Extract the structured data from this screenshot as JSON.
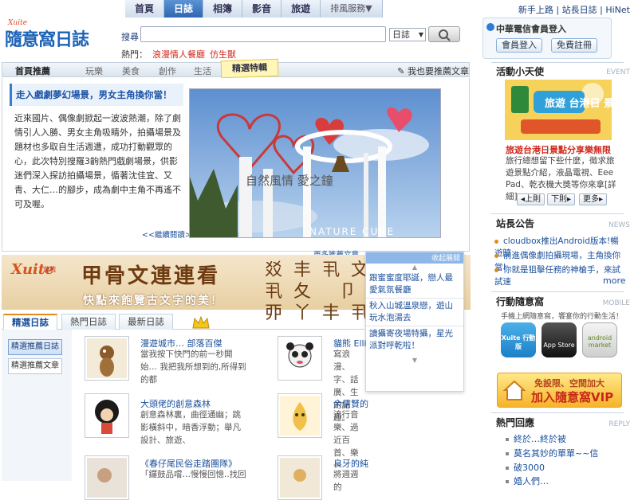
{
  "nav": {
    "tabs": [
      "首頁",
      "日誌",
      "相簿",
      "影音",
      "旅遊"
    ],
    "active_index": 1,
    "more": "排風服務▼",
    "top_links": [
      "新手上路",
      "站長日誌",
      "HiNet"
    ],
    "sep": "|"
  },
  "logo": {
    "xuite": "Xuite",
    "name": "隨意窩日誌"
  },
  "search": {
    "label": "搜尋",
    "value": "",
    "scope": "日誌",
    "hot_label": "熱門：",
    "hot_items": [
      "浪漫情人餐廳",
      "仿生獸"
    ]
  },
  "member": {
    "title": "中華電信會員登入",
    "login": "會員登入",
    "register": "免費註冊"
  },
  "main_tabs": {
    "first": "首頁推薦",
    "items": [
      "玩樂",
      "美食",
      "創作",
      "生活"
    ],
    "featured_badge": "精選特輯",
    "recent": "我也要推薦文章"
  },
  "feature": {
    "title": "走入戲劇夢幻場景，男女主角換你當！",
    "body": "近來國片、偶像劇掀起一波波熱潮，除了劇情引人入勝、男女主角吸睛外，拍攝場景及題材也多取自生活週遭，成功打動觀眾的心，此次特別搜羅3齣熱門戲劇場景，供影迷們深入探訪拍攝場景，循著沈佳宜、又青、大仁…的腳步，成為劇中主角不再遙不可及喔。",
    "more": "<<繼續閱讀>>",
    "photo_text": "自然風情 愛之鐘",
    "photo_text2": "NATURE     CURE",
    "more_recommend": "更多推薦文章"
  },
  "banner": {
    "xuite": "Xuite",
    "game": "遊戲",
    "title": "甲骨文連連看",
    "sub": "快點來飽覽古文字的美！",
    "glyphs": "㸚丰丮文 丣丰丮夂 卩丩丰丮 丣丫丰丮"
  },
  "overlay": {
    "items": [
      "跟蜜蜜度耶誕，戀人最愛氣氛餐廳",
      "秋入山城溫泉戀，遊山玩水泡湯去",
      "讀攝寄夜場特攝，星光派對呼乾啦！"
    ],
    "tag": "收起展開"
  },
  "bottom_tabs": [
    "精選日誌",
    "熱門日誌",
    "最新日誌"
  ],
  "left_nav": [
    "精選推薦日誌",
    "精選推薦文章"
  ],
  "entries": [
    {
      "title": "漫遊城市…  部落百傑",
      "body": "當我按下快門的前一秒開始… 我把我所想到的,所得到的都",
      "col": 0
    },
    {
      "title": "大頭佬的創意森林",
      "body": "創意森林裏，曲徑通幽；跳影橫斜中，暗香浮動；舉凡設計、旅遊、",
      "col": 0
    },
    {
      "title": "《春仔尾民俗走踏團隊》",
      "body": "「鑼鼓品嚐…慢慢回憶..找回",
      "col": 0
    },
    {
      "title": "貓熊 Elli",
      "body": "寫浪漫、字、話廣、生的記趣。",
      "col": 1
    },
    {
      "title": "余儒賢的",
      "body": "流行音樂、過近百首、樂 一",
      "col": 1
    },
    {
      "title": "良牙的純",
      "body": "將週週的",
      "col": 1
    }
  ],
  "right": {
    "activity_title": "活動小天使",
    "activity_tag": "EVENT",
    "promo_title": "旅遊台港日景點分享樂無限",
    "promo_body": "旅行總想留下些什麼，徵求旅遊景點介紹，液晶電視、Eee Pad、乾衣機大獎等你來拿[詳細]",
    "promo_img_text": "旅遊 台港日 景點分享樂無限",
    "buttons": [
      "上則",
      "下則",
      "更多"
    ],
    "news_title": "站長公告",
    "news_tag": "NEWS",
    "news": [
      "cloudbox推出Android版本!暢遊隨",
      "前進偶像劇拍攝現場，主角換你當!",
      "你就是狙擊任務的神槍手，來試試速"
    ],
    "news_more": "more",
    "mobile_title": "行動隨意窩",
    "mobile_tag": "MOBILE",
    "mobile_desc": "手機上網隨意窩，饗宴你的行動生活！",
    "mobile_icons": [
      "Xuite 行動版",
      "App Store",
      "android market"
    ],
    "vip_a": "免設限、空間加大",
    "vip_b": "加入隨意窩VIP",
    "hot_title": "熱門回應",
    "hot_tag": "REPLY",
    "hot": [
      "終於…終於被",
      "莫名其妙的單單~~信",
      "破3000",
      "婚人們…"
    ]
  }
}
